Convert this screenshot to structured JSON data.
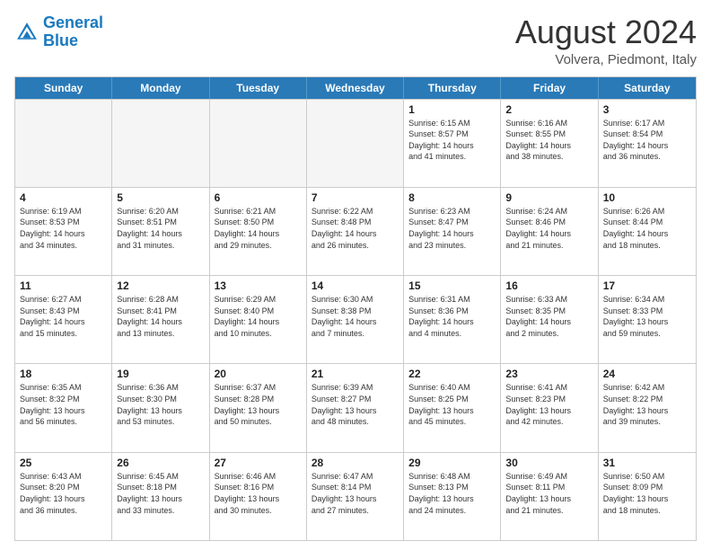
{
  "header": {
    "logo_general": "General",
    "logo_blue": "Blue",
    "title": "August 2024",
    "location": "Volvera, Piedmont, Italy"
  },
  "calendar": {
    "days": [
      "Sunday",
      "Monday",
      "Tuesday",
      "Wednesday",
      "Thursday",
      "Friday",
      "Saturday"
    ],
    "rows": [
      [
        {
          "day": "",
          "empty": true
        },
        {
          "day": "",
          "empty": true
        },
        {
          "day": "",
          "empty": true
        },
        {
          "day": "",
          "empty": true
        },
        {
          "day": "1",
          "lines": [
            "Sunrise: 6:15 AM",
            "Sunset: 8:57 PM",
            "Daylight: 14 hours",
            "and 41 minutes."
          ]
        },
        {
          "day": "2",
          "lines": [
            "Sunrise: 6:16 AM",
            "Sunset: 8:55 PM",
            "Daylight: 14 hours",
            "and 38 minutes."
          ]
        },
        {
          "day": "3",
          "lines": [
            "Sunrise: 6:17 AM",
            "Sunset: 8:54 PM",
            "Daylight: 14 hours",
            "and 36 minutes."
          ]
        }
      ],
      [
        {
          "day": "4",
          "lines": [
            "Sunrise: 6:19 AM",
            "Sunset: 8:53 PM",
            "Daylight: 14 hours",
            "and 34 minutes."
          ]
        },
        {
          "day": "5",
          "lines": [
            "Sunrise: 6:20 AM",
            "Sunset: 8:51 PM",
            "Daylight: 14 hours",
            "and 31 minutes."
          ]
        },
        {
          "day": "6",
          "lines": [
            "Sunrise: 6:21 AM",
            "Sunset: 8:50 PM",
            "Daylight: 14 hours",
            "and 29 minutes."
          ]
        },
        {
          "day": "7",
          "lines": [
            "Sunrise: 6:22 AM",
            "Sunset: 8:48 PM",
            "Daylight: 14 hours",
            "and 26 minutes."
          ]
        },
        {
          "day": "8",
          "lines": [
            "Sunrise: 6:23 AM",
            "Sunset: 8:47 PM",
            "Daylight: 14 hours",
            "and 23 minutes."
          ]
        },
        {
          "day": "9",
          "lines": [
            "Sunrise: 6:24 AM",
            "Sunset: 8:46 PM",
            "Daylight: 14 hours",
            "and 21 minutes."
          ]
        },
        {
          "day": "10",
          "lines": [
            "Sunrise: 6:26 AM",
            "Sunset: 8:44 PM",
            "Daylight: 14 hours",
            "and 18 minutes."
          ]
        }
      ],
      [
        {
          "day": "11",
          "lines": [
            "Sunrise: 6:27 AM",
            "Sunset: 8:43 PM",
            "Daylight: 14 hours",
            "and 15 minutes."
          ]
        },
        {
          "day": "12",
          "lines": [
            "Sunrise: 6:28 AM",
            "Sunset: 8:41 PM",
            "Daylight: 14 hours",
            "and 13 minutes."
          ]
        },
        {
          "day": "13",
          "lines": [
            "Sunrise: 6:29 AM",
            "Sunset: 8:40 PM",
            "Daylight: 14 hours",
            "and 10 minutes."
          ]
        },
        {
          "day": "14",
          "lines": [
            "Sunrise: 6:30 AM",
            "Sunset: 8:38 PM",
            "Daylight: 14 hours",
            "and 7 minutes."
          ]
        },
        {
          "day": "15",
          "lines": [
            "Sunrise: 6:31 AM",
            "Sunset: 8:36 PM",
            "Daylight: 14 hours",
            "and 4 minutes."
          ]
        },
        {
          "day": "16",
          "lines": [
            "Sunrise: 6:33 AM",
            "Sunset: 8:35 PM",
            "Daylight: 14 hours",
            "and 2 minutes."
          ]
        },
        {
          "day": "17",
          "lines": [
            "Sunrise: 6:34 AM",
            "Sunset: 8:33 PM",
            "Daylight: 13 hours",
            "and 59 minutes."
          ]
        }
      ],
      [
        {
          "day": "18",
          "lines": [
            "Sunrise: 6:35 AM",
            "Sunset: 8:32 PM",
            "Daylight: 13 hours",
            "and 56 minutes."
          ]
        },
        {
          "day": "19",
          "lines": [
            "Sunrise: 6:36 AM",
            "Sunset: 8:30 PM",
            "Daylight: 13 hours",
            "and 53 minutes."
          ]
        },
        {
          "day": "20",
          "lines": [
            "Sunrise: 6:37 AM",
            "Sunset: 8:28 PM",
            "Daylight: 13 hours",
            "and 50 minutes."
          ]
        },
        {
          "day": "21",
          "lines": [
            "Sunrise: 6:39 AM",
            "Sunset: 8:27 PM",
            "Daylight: 13 hours",
            "and 48 minutes."
          ]
        },
        {
          "day": "22",
          "lines": [
            "Sunrise: 6:40 AM",
            "Sunset: 8:25 PM",
            "Daylight: 13 hours",
            "and 45 minutes."
          ]
        },
        {
          "day": "23",
          "lines": [
            "Sunrise: 6:41 AM",
            "Sunset: 8:23 PM",
            "Daylight: 13 hours",
            "and 42 minutes."
          ]
        },
        {
          "day": "24",
          "lines": [
            "Sunrise: 6:42 AM",
            "Sunset: 8:22 PM",
            "Daylight: 13 hours",
            "and 39 minutes."
          ]
        }
      ],
      [
        {
          "day": "25",
          "lines": [
            "Sunrise: 6:43 AM",
            "Sunset: 8:20 PM",
            "Daylight: 13 hours",
            "and 36 minutes."
          ]
        },
        {
          "day": "26",
          "lines": [
            "Sunrise: 6:45 AM",
            "Sunset: 8:18 PM",
            "Daylight: 13 hours",
            "and 33 minutes."
          ]
        },
        {
          "day": "27",
          "lines": [
            "Sunrise: 6:46 AM",
            "Sunset: 8:16 PM",
            "Daylight: 13 hours",
            "and 30 minutes."
          ]
        },
        {
          "day": "28",
          "lines": [
            "Sunrise: 6:47 AM",
            "Sunset: 8:14 PM",
            "Daylight: 13 hours",
            "and 27 minutes."
          ]
        },
        {
          "day": "29",
          "lines": [
            "Sunrise: 6:48 AM",
            "Sunset: 8:13 PM",
            "Daylight: 13 hours",
            "and 24 minutes."
          ]
        },
        {
          "day": "30",
          "lines": [
            "Sunrise: 6:49 AM",
            "Sunset: 8:11 PM",
            "Daylight: 13 hours",
            "and 21 minutes."
          ]
        },
        {
          "day": "31",
          "lines": [
            "Sunrise: 6:50 AM",
            "Sunset: 8:09 PM",
            "Daylight: 13 hours",
            "and 18 minutes."
          ]
        }
      ]
    ]
  }
}
